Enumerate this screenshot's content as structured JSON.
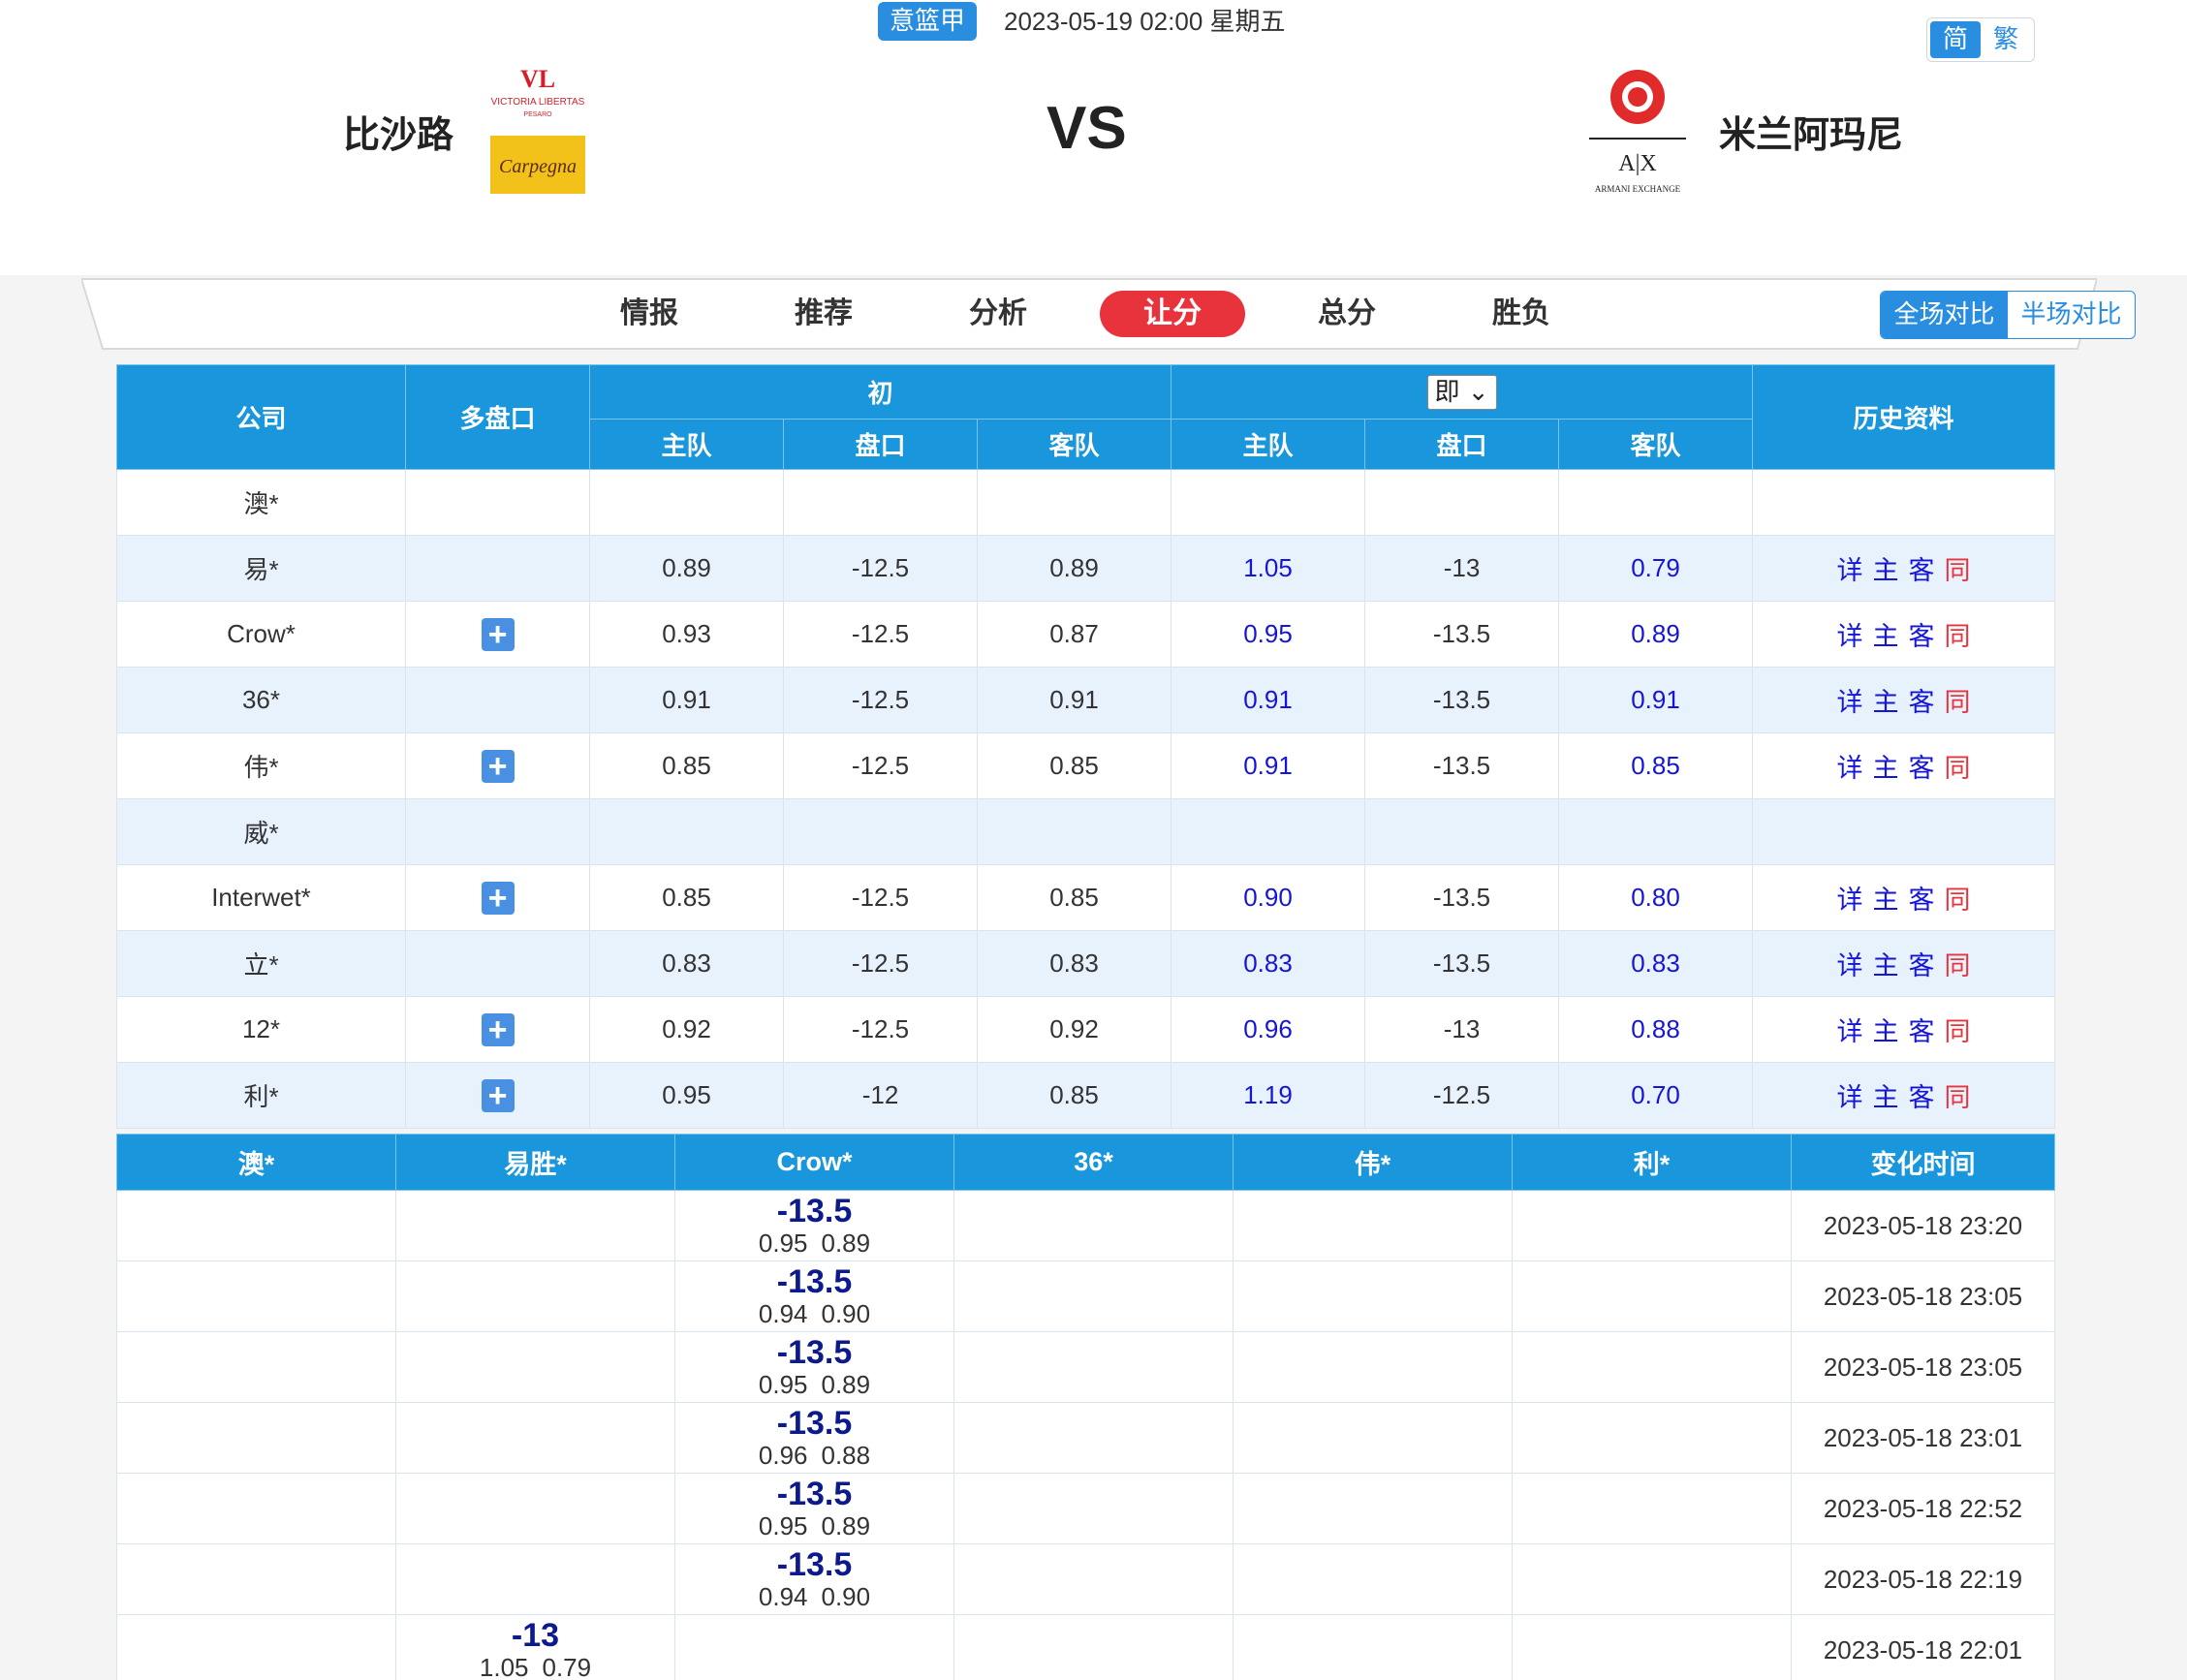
{
  "header": {
    "league": "意篮甲",
    "datetime": "2023-05-19 02:00 星期五",
    "lang": [
      "简",
      "繁"
    ],
    "home_team": "比沙路",
    "away_team": "米兰阿玛尼",
    "vs": "VS"
  },
  "tabs": [
    "情报",
    "推荐",
    "分析",
    "让分",
    "总分",
    "胜负"
  ],
  "active_tab": "让分",
  "compare": [
    "全场对比",
    "半场对比"
  ],
  "odds_table": {
    "headers": {
      "company": "公司",
      "multi": "多盘口",
      "initial": "初",
      "live": "即",
      "history": "历史资料",
      "sub": [
        "主队",
        "盘口",
        "客队",
        "主队",
        "盘口",
        "客队"
      ]
    },
    "hist_links": [
      "详",
      "主",
      "客",
      "同"
    ],
    "rows": [
      {
        "company": "澳*",
        "multi": false,
        "init": [
          "",
          "",
          ""
        ],
        "live": [
          "",
          "",
          ""
        ],
        "hist": false
      },
      {
        "company": "易*",
        "multi": false,
        "init": [
          "0.89",
          "-12.5",
          "0.89"
        ],
        "live": [
          "1.05",
          "-13",
          "0.79"
        ],
        "hist": true
      },
      {
        "company": "Crow*",
        "multi": true,
        "init": [
          "0.93",
          "-12.5",
          "0.87"
        ],
        "live": [
          "0.95",
          "-13.5",
          "0.89"
        ],
        "hist": true
      },
      {
        "company": "36*",
        "multi": false,
        "init": [
          "0.91",
          "-12.5",
          "0.91"
        ],
        "live": [
          "0.91",
          "-13.5",
          "0.91"
        ],
        "hist": true
      },
      {
        "company": "伟*",
        "multi": true,
        "init": [
          "0.85",
          "-12.5",
          "0.85"
        ],
        "live": [
          "0.91",
          "-13.5",
          "0.85"
        ],
        "hist": true
      },
      {
        "company": "威*",
        "multi": false,
        "init": [
          "",
          "",
          ""
        ],
        "live": [
          "",
          "",
          ""
        ],
        "hist": false
      },
      {
        "company": "Interwet*",
        "multi": true,
        "init": [
          "0.85",
          "-12.5",
          "0.85"
        ],
        "live": [
          "0.90",
          "-13.5",
          "0.80"
        ],
        "hist": true
      },
      {
        "company": "立*",
        "multi": false,
        "init": [
          "0.83",
          "-12.5",
          "0.83"
        ],
        "live": [
          "0.83",
          "-13.5",
          "0.83"
        ],
        "hist": true
      },
      {
        "company": "12*",
        "multi": true,
        "init": [
          "0.92",
          "-12.5",
          "0.92"
        ],
        "live": [
          "0.96",
          "-13",
          "0.88"
        ],
        "hist": true
      },
      {
        "company": "利*",
        "multi": true,
        "init": [
          "0.95",
          "-12",
          "0.85"
        ],
        "live": [
          "1.19",
          "-12.5",
          "0.70"
        ],
        "hist": true
      }
    ]
  },
  "change_table": {
    "headers": [
      "澳*",
      "易胜*",
      "Crow*",
      "36*",
      "伟*",
      "利*",
      "变化时间"
    ],
    "rows": [
      {
        "col": 2,
        "line": "-13.5",
        "home": "0.95",
        "away": "0.89",
        "time": "2023-05-18 23:20"
      },
      {
        "col": 2,
        "line": "-13.5",
        "home": "0.94",
        "away": "0.90",
        "time": "2023-05-18 23:05"
      },
      {
        "col": 2,
        "line": "-13.5",
        "home": "0.95",
        "away": "0.89",
        "time": "2023-05-18 23:05"
      },
      {
        "col": 2,
        "line": "-13.5",
        "home": "0.96",
        "away": "0.88",
        "time": "2023-05-18 23:01"
      },
      {
        "col": 2,
        "line": "-13.5",
        "home": "0.95",
        "away": "0.89",
        "time": "2023-05-18 22:52"
      },
      {
        "col": 2,
        "line": "-13.5",
        "home": "0.94",
        "away": "0.90",
        "time": "2023-05-18 22:19"
      },
      {
        "col": 1,
        "line": "-13",
        "home": "1.05",
        "away": "0.79",
        "time": "2023-05-18 22:01"
      }
    ]
  },
  "colors": {
    "header_blue": "#1a96dc",
    "active_red": "#e8333c",
    "live_blue": "#1515d8",
    "row_alt": "#e8f2fd"
  }
}
